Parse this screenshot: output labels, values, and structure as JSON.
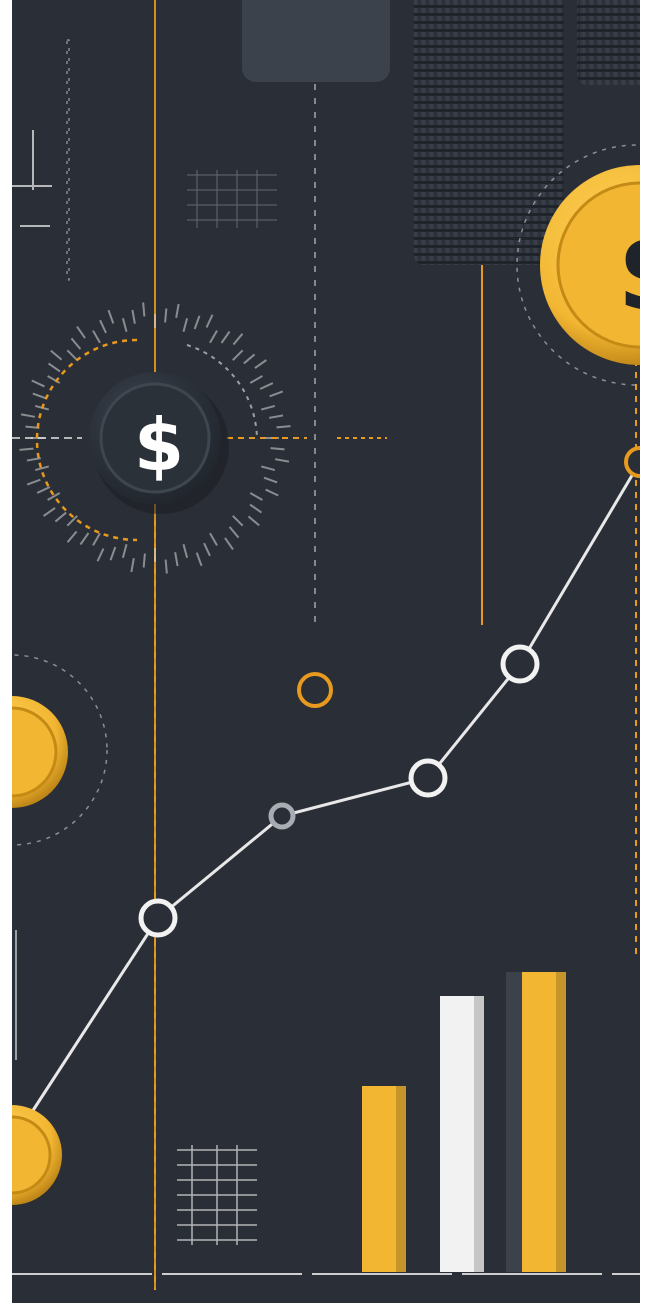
{
  "scene": {
    "type": "illustration",
    "theme": "finance / growth",
    "palette": {
      "background": "#2a2f37",
      "gold": "#f2b632",
      "gold_dark": "#c48a16",
      "accent_orange": "#e79a1d",
      "white": "#f2f2f2",
      "slate": "#3b424b"
    }
  },
  "coins": {
    "symbol": "$"
  },
  "trend_line": {
    "point_count": 7
  },
  "bar_chart": {
    "values": [
      0.62,
      0.92,
      1.0
    ],
    "colors": [
      "#f2b632",
      "#f2f2f2",
      "#f2b632"
    ]
  }
}
